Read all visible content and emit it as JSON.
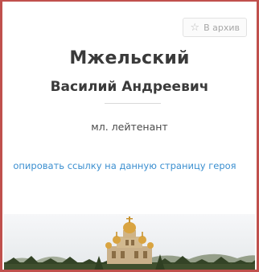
{
  "archive_button": {
    "label": "В архив",
    "icon": "star-outline-icon"
  },
  "hero": {
    "surname": "Мжельский",
    "given_names": "Василий Андреевич",
    "rank": "мл. лейтенант"
  },
  "copy_link": {
    "text": "опировать ссылку на данную страницу героя"
  },
  "photo": {
    "subject": "cathedral-photo"
  },
  "colors": {
    "frame": "#c0504d",
    "link": "#3b8fd0",
    "gold": "#d9a441"
  }
}
